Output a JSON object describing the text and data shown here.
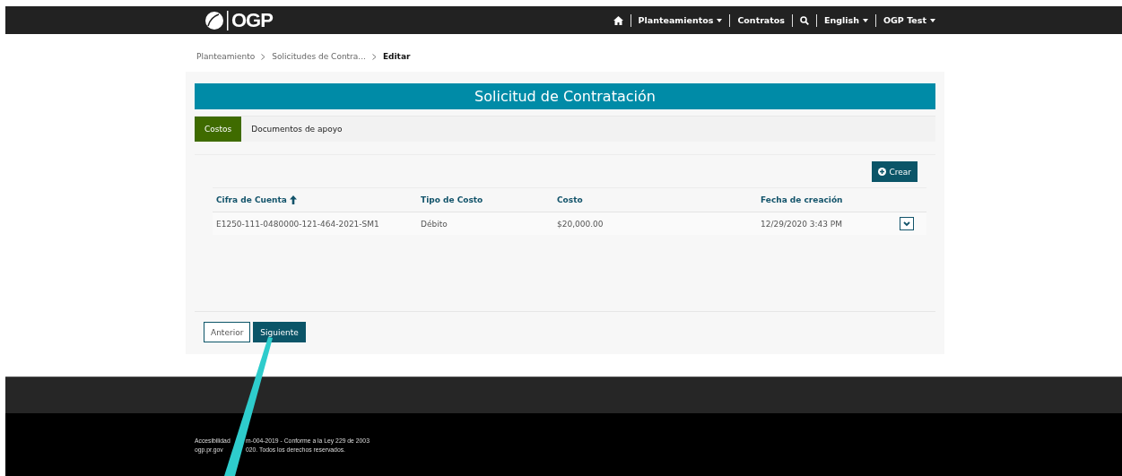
{
  "navbar": {
    "logo_text": "OGP",
    "items": [
      {
        "kind": "icon"
      },
      {
        "kind": "dropdown",
        "label": "Planteamientos"
      },
      {
        "kind": "link",
        "label": "Contratos"
      },
      {
        "kind": "search"
      },
      {
        "kind": "dropdown",
        "label": "English"
      },
      {
        "kind": "dropdown",
        "label": "OGP Test"
      }
    ]
  },
  "breadcrumb": [
    {
      "label": "Planteamiento",
      "current": false
    },
    {
      "label": "Solicitudes de Contra...",
      "current": false
    },
    {
      "label": "Editar",
      "current": true
    }
  ],
  "panel": {
    "title": "Solicitud de Contratación",
    "tabs": [
      {
        "label": "Costos",
        "selected": true
      },
      {
        "label": "Documentos de apoyo",
        "selected": false
      }
    ],
    "create_button": "Crear",
    "table": {
      "columns": [
        {
          "label": "Cifra de Cuenta",
          "sorted": true
        },
        {
          "label": "Tipo de Costo",
          "sorted": false
        },
        {
          "label": "Costo",
          "sorted": false
        },
        {
          "label": "Fecha de creación",
          "sorted": false
        }
      ],
      "rows": [
        {
          "cells": [
            "E1250-111-0480000-121-464-2021-SM1",
            "Débito",
            "$20,000.00",
            "12/29/2020 3:43 PM"
          ]
        }
      ]
    },
    "buttons": [
      {
        "label": "Anterior",
        "kind": "outline"
      },
      {
        "label": "Siguiente",
        "kind": "primary"
      }
    ]
  },
  "footer": {
    "lines": [
      [
        "Accesibilidad",
        "m-004-2019 - Conforme a la Ley 229 de 2003"
      ],
      [
        "ogp.pr.gov",
        "020. Todos los derechos reservados."
      ]
    ]
  }
}
